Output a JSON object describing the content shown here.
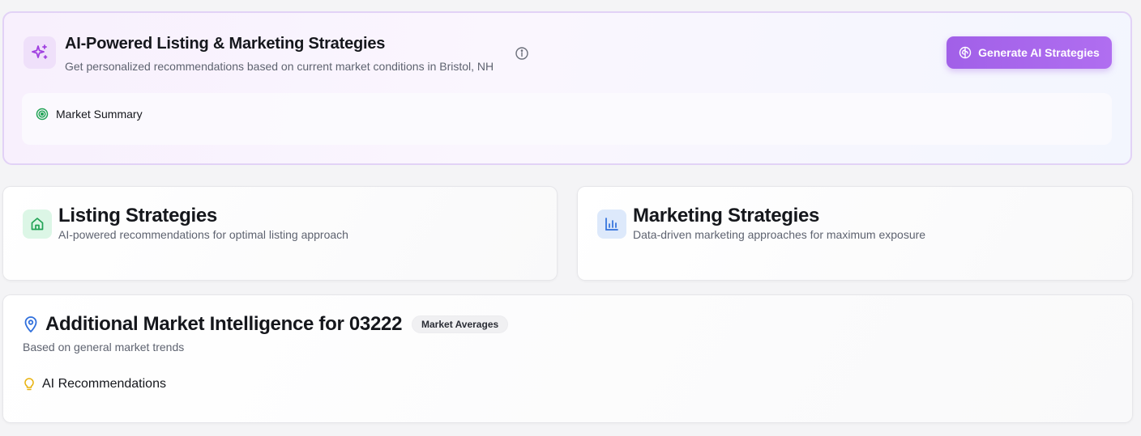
{
  "hero": {
    "title": "AI-Powered Listing & Marketing Strategies",
    "subtitle": "Get personalized recommendations based on current market conditions in Bristol, NH",
    "icon": "sparkles-icon",
    "info_icon": "info-icon",
    "generate_button_label": "Generate AI Strategies",
    "generate_button_icon": "brain-icon",
    "accent_color": "#a463ea",
    "summary": {
      "label": "Market Summary",
      "icon": "target-icon",
      "icon_color": "#22a356"
    }
  },
  "listing": {
    "title": "Listing Strategies",
    "subtitle": "AI-powered recommendations for optimal listing approach",
    "icon": "home-icon",
    "icon_color": "#22a356"
  },
  "marketing": {
    "title": "Marketing Strategies",
    "subtitle": "Data-driven marketing approaches for maximum exposure",
    "icon": "bar-chart-icon",
    "icon_color": "#2f6fdc"
  },
  "intel": {
    "title": "Additional Market Intelligence for 03222",
    "badge": "Market Averages",
    "subtitle": "Based on general market trends",
    "icon": "map-pin-icon",
    "icon_color": "#2f6fdc",
    "recommendations": {
      "label": "AI Recommendations",
      "icon": "lightbulb-icon",
      "icon_color": "#e8b10c"
    }
  }
}
